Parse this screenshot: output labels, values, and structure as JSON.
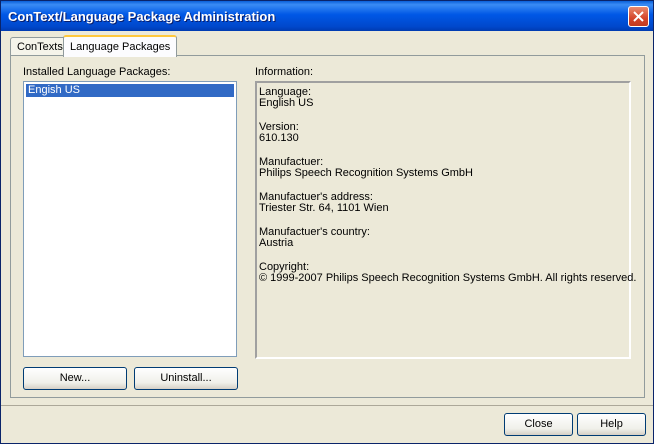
{
  "window": {
    "title": "ConText/Language Package Administration"
  },
  "tabs": [
    {
      "label": "ConTexts"
    },
    {
      "label": "Language Packages"
    }
  ],
  "installed": {
    "label": "Installed Language Packages:",
    "items": [
      "Engish US"
    ]
  },
  "info": {
    "label": "Information:",
    "lines": [
      "Language:",
      "English US",
      "",
      "Version:",
      "610.130",
      "",
      "Manufactuer:",
      "Philips Speech Recognition Systems GmbH",
      "",
      "Manufactuer's address:",
      "Triester Str. 64, 1101 Wien",
      "",
      "Manufactuer's country:",
      "Austria",
      "",
      "Copyright:",
      "© 1999-2007 Philips Speech Recognition Systems GmbH. All rights reserved."
    ]
  },
  "buttons": {
    "new": "New...",
    "uninstall": "Uninstall...",
    "close": "Close",
    "help": "Help"
  },
  "colors": {
    "title_bar": "#0058e6",
    "selection": "#316ac5",
    "tab_highlight": "#ffc83c"
  }
}
